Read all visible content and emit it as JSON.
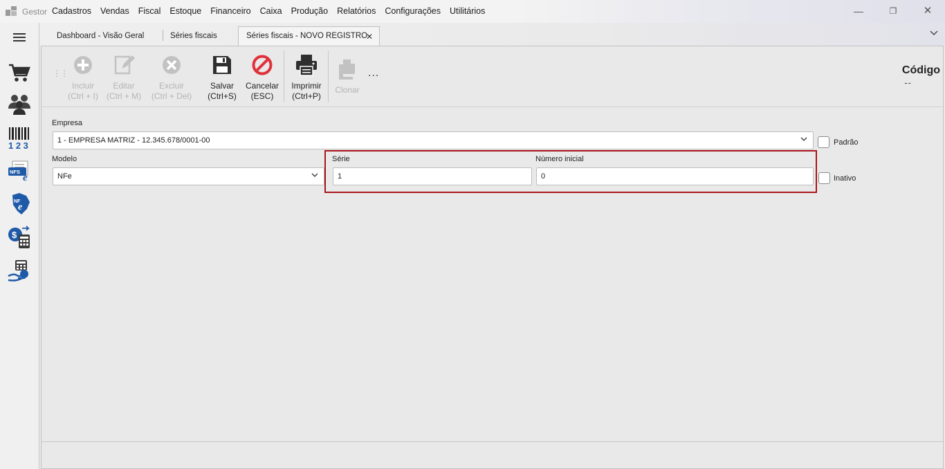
{
  "app": {
    "name": "Gestor"
  },
  "menu": [
    "Cadastros",
    "Vendas",
    "Fiscal",
    "Estoque",
    "Financeiro",
    "Caixa",
    "Produção",
    "Relatórios",
    "Configurações",
    "Utilitários"
  ],
  "window_controls": {
    "minimize": "—",
    "restore": "❐",
    "close": "✕"
  },
  "tabs": [
    {
      "label": "Dashboard - Visão Geral"
    },
    {
      "label": "Séries fiscais"
    },
    {
      "label": "Séries fiscais - NOVO REGISTRO",
      "active": true,
      "close": "✕"
    }
  ],
  "toolbar": {
    "incluir": {
      "label": "Incluir",
      "shortcut": "(Ctrl + I)"
    },
    "editar": {
      "label": "Editar",
      "shortcut": "(Ctrl + M)"
    },
    "excluir": {
      "label": "Excluir",
      "shortcut": "(Ctrl + Del)"
    },
    "salvar": {
      "label": "Salvar",
      "shortcut": "(Ctrl+S)"
    },
    "cancelar": {
      "label": "Cancelar",
      "shortcut": "(ESC)"
    },
    "imprimir": {
      "label": "Imprimir",
      "shortcut": "(Ctrl+P)"
    },
    "clonar": {
      "label": "Clonar"
    },
    "more": "..."
  },
  "record": {
    "codigo_label": "Código",
    "codigo_value": "--"
  },
  "form": {
    "empresa": {
      "label": "Empresa",
      "value": "1 - EMPRESA MATRIZ - 12.345.678/0001-00"
    },
    "padrao": {
      "label": "Padrão"
    },
    "modelo": {
      "label": "Modelo",
      "value": "NFe"
    },
    "serie": {
      "label": "Série",
      "value": "1"
    },
    "numero_inicial": {
      "label": "Número inicial",
      "value": "0"
    },
    "inativo": {
      "label": "Inativo"
    }
  },
  "colors": {
    "highlight": "#a8141a",
    "cancel_red": "#e0313a",
    "icon_dark": "#2f2f2f",
    "icon_blue": "#1f5aa8"
  },
  "sidebar_icons": [
    "menu-icon",
    "cart-icon",
    "users-icon",
    "barcode-icon",
    "nfse-icon",
    "nfe-icon",
    "cash-calculator-icon",
    "payment-icon"
  ]
}
